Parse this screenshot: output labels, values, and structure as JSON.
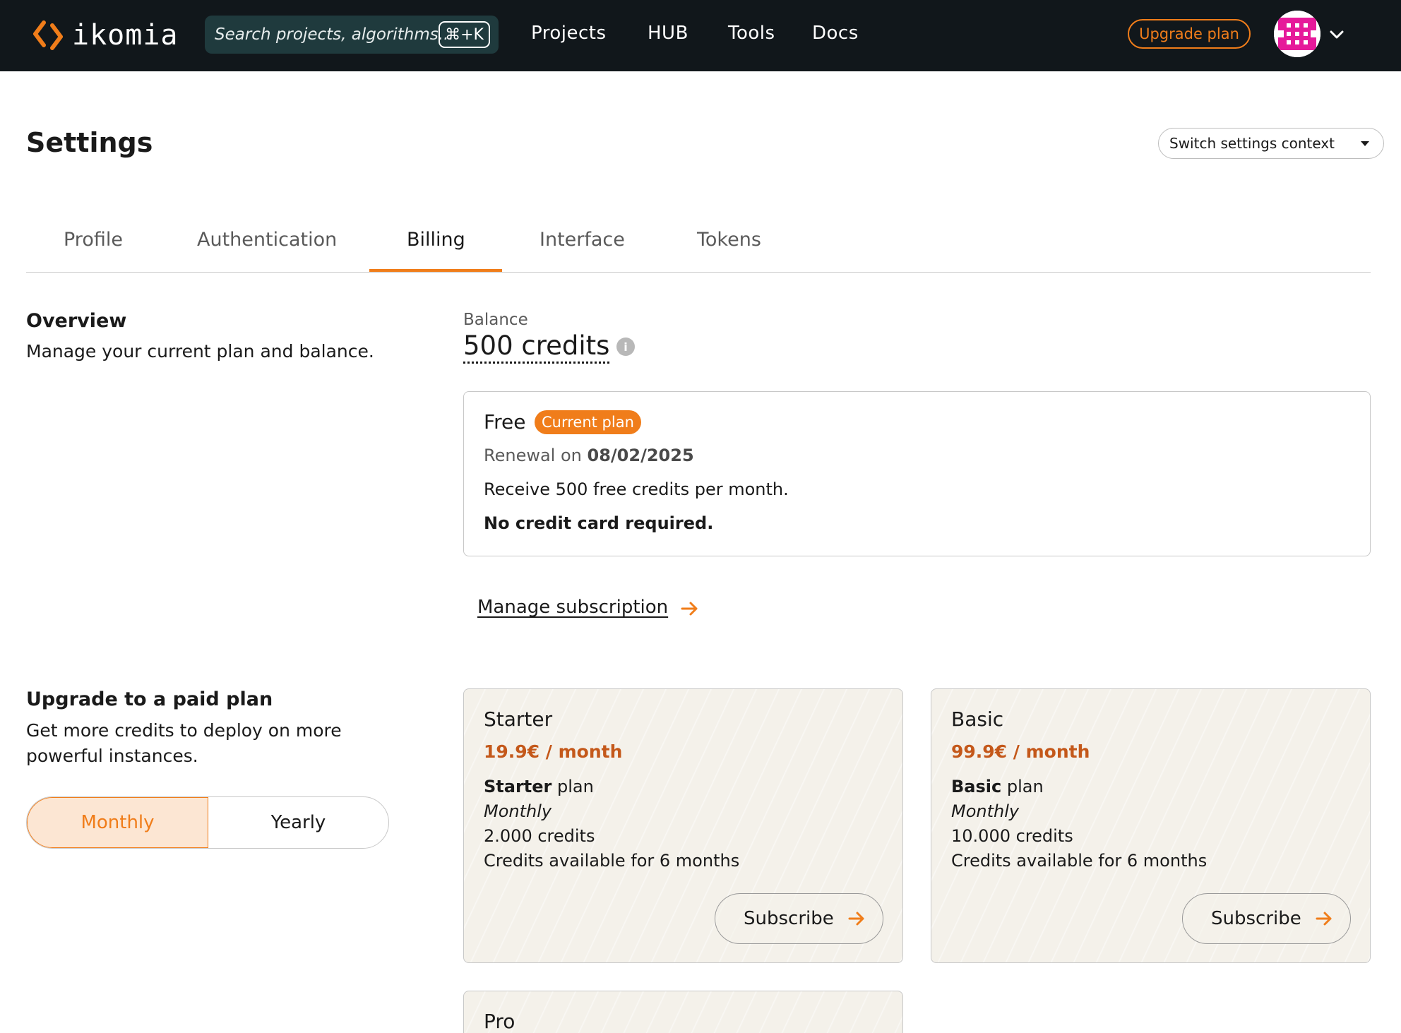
{
  "app": {
    "logo_text": "ikomia",
    "accent": "#f07d1a",
    "nav_bg": "#11171b"
  },
  "nav": {
    "search_placeholder": "Search projects, algorithms...",
    "search_shortcut": "⌘+K",
    "links": [
      "Projects",
      "HUB",
      "Tools",
      "Docs"
    ],
    "upgrade_label": "Upgrade plan"
  },
  "header": {
    "title": "Settings",
    "context_switch": "Switch settings context"
  },
  "tabs": [
    {
      "label": "Profile",
      "active": false
    },
    {
      "label": "Authentication",
      "active": false
    },
    {
      "label": "Billing",
      "active": true
    },
    {
      "label": "Interface",
      "active": false
    },
    {
      "label": "Tokens",
      "active": false
    }
  ],
  "overview": {
    "title": "Overview",
    "description": "Manage your current plan and balance.",
    "balance_label": "Balance",
    "balance_value": "500 credits",
    "current_plan": {
      "name": "Free",
      "badge": "Current plan",
      "renewal_prefix": "Renewal on",
      "renewal_date": "08/02/2025",
      "line1": "Receive 500 free credits per month.",
      "line2": "No credit card required."
    },
    "manage_link": "Manage subscription"
  },
  "upgrade": {
    "title": "Upgrade to a paid plan",
    "description_line1": "Get more credits to deploy on more",
    "description_line2": "powerful instances.",
    "toggle": {
      "monthly": "Monthly",
      "yearly": "Yearly",
      "selected": "Monthly"
    },
    "plans": [
      {
        "name": "Starter",
        "price": "19.9€ / month",
        "plan_bold": "Starter",
        "plan_suffix": " plan",
        "period": "Monthly",
        "credits": "2.000 credits",
        "availability": "Credits available for 6 months",
        "cta": "Subscribe"
      },
      {
        "name": "Basic",
        "price": "99.9€ / month",
        "plan_bold": "Basic",
        "plan_suffix": " plan",
        "period": "Monthly",
        "credits": "10.000 credits",
        "availability": "Credits available for 6 months",
        "cta": "Subscribe"
      },
      {
        "name": "Pro"
      }
    ]
  }
}
